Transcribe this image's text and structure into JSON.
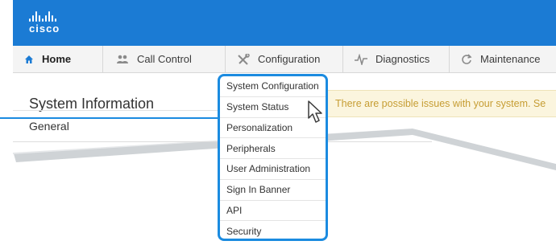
{
  "brand": {
    "logo_text": "cisco",
    "logo_icon": "cisco-bars-icon",
    "color": "#1b7bd4"
  },
  "nav": {
    "tabs": [
      {
        "label": "Home",
        "icon": "home-icon",
        "active": true
      },
      {
        "label": "Call Control",
        "icon": "people-icon"
      },
      {
        "label": "Configuration",
        "icon": "wrench-screwdriver-icon"
      },
      {
        "label": "Diagnostics",
        "icon": "pulse-icon"
      },
      {
        "label": "Maintenance",
        "icon": "refresh-icon"
      }
    ]
  },
  "page": {
    "title": "System Information",
    "section": "General",
    "alert": "There are possible issues with your system. Se"
  },
  "configuration_menu": {
    "items": [
      "System Configuration",
      "System Status",
      "Personalization",
      "Peripherals",
      "User Administration",
      "Sign In Banner",
      "API",
      "Security"
    ],
    "highlight_color": "#1b8be0"
  }
}
